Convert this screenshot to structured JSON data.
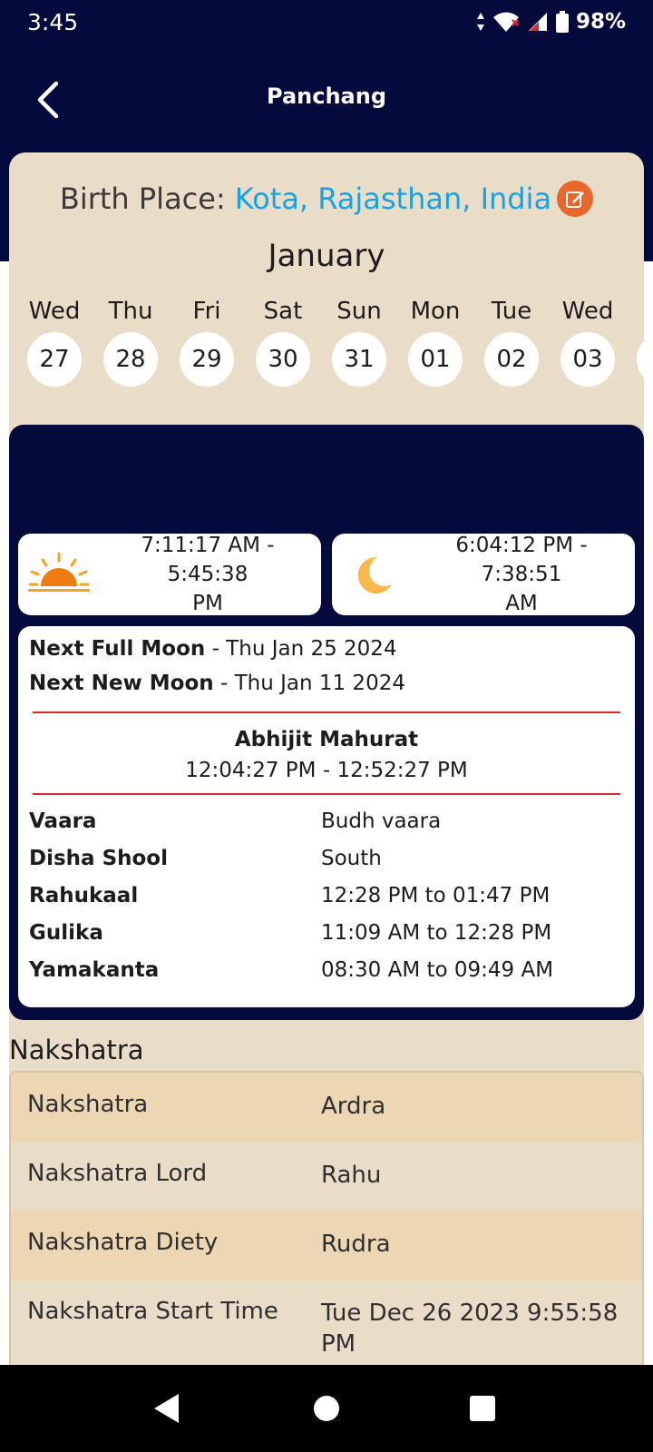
{
  "status": {
    "time": "3:45",
    "battery": "98%"
  },
  "header": {
    "title": "Panchang"
  },
  "birth": {
    "label": "Birth Place:",
    "value": "Kota, Rajasthan, India"
  },
  "month": "January",
  "days": [
    {
      "name": "Wed",
      "num": "27"
    },
    {
      "name": "Thu",
      "num": "28"
    },
    {
      "name": "Fri",
      "num": "29"
    },
    {
      "name": "Sat",
      "num": "30"
    },
    {
      "name": "Sun",
      "num": "31"
    },
    {
      "name": "Mon",
      "num": "01"
    },
    {
      "name": "Tue",
      "num": "02"
    },
    {
      "name": "Wed",
      "num": "03"
    },
    {
      "name": "T",
      "num": ""
    }
  ],
  "sun": {
    "line1": "7:11:17 AM - 5:45:38",
    "line2": "PM"
  },
  "moon": {
    "line1": "6:04:12 PM - 7:38:51",
    "line2": "AM"
  },
  "next_full_moon": {
    "label": "Next Full Moon",
    "value": " - Thu Jan 25 2024"
  },
  "next_new_moon": {
    "label": "Next New Moon",
    "value": " - Thu Jan 11 2024"
  },
  "abhijit": {
    "label": "Abhijit Mahurat",
    "value": "12:04:27 PM - 12:52:27 PM"
  },
  "details": [
    {
      "key": "Vaara",
      "value": "Budh vaara"
    },
    {
      "key": "Disha Shool",
      "value": "South"
    },
    {
      "key": "Rahukaal",
      "value": "12:28 PM to 01:47 PM"
    },
    {
      "key": "Gulika",
      "value": "11:09 AM to 12:28 PM"
    },
    {
      "key": "Yamakanta",
      "value": "08:30 AM to 09:49 AM"
    }
  ],
  "nakshatra": {
    "title": "Nakshatra",
    "rows": [
      {
        "key": "Nakshatra",
        "value": "Ardra"
      },
      {
        "key": "Nakshatra Lord",
        "value": "Rahu"
      },
      {
        "key": "Nakshatra Diety",
        "value": "Rudra"
      },
      {
        "key": "Nakshatra Start Time",
        "value": "Tue Dec 26 2023 9:55:58 PM"
      }
    ]
  },
  "colors": {
    "navy": "#050a3c",
    "accent_blue": "#17a2e6",
    "edit_orange": "#e8672a",
    "beige": "#e9ddc8",
    "row_highlight": "#ecd6b4",
    "divider_red": "#e0272f"
  },
  "icons": {
    "back": "chevron-left-icon",
    "edit": "edit-icon",
    "sun": "sunrise-icon",
    "moon": "crescent-moon-icon"
  }
}
